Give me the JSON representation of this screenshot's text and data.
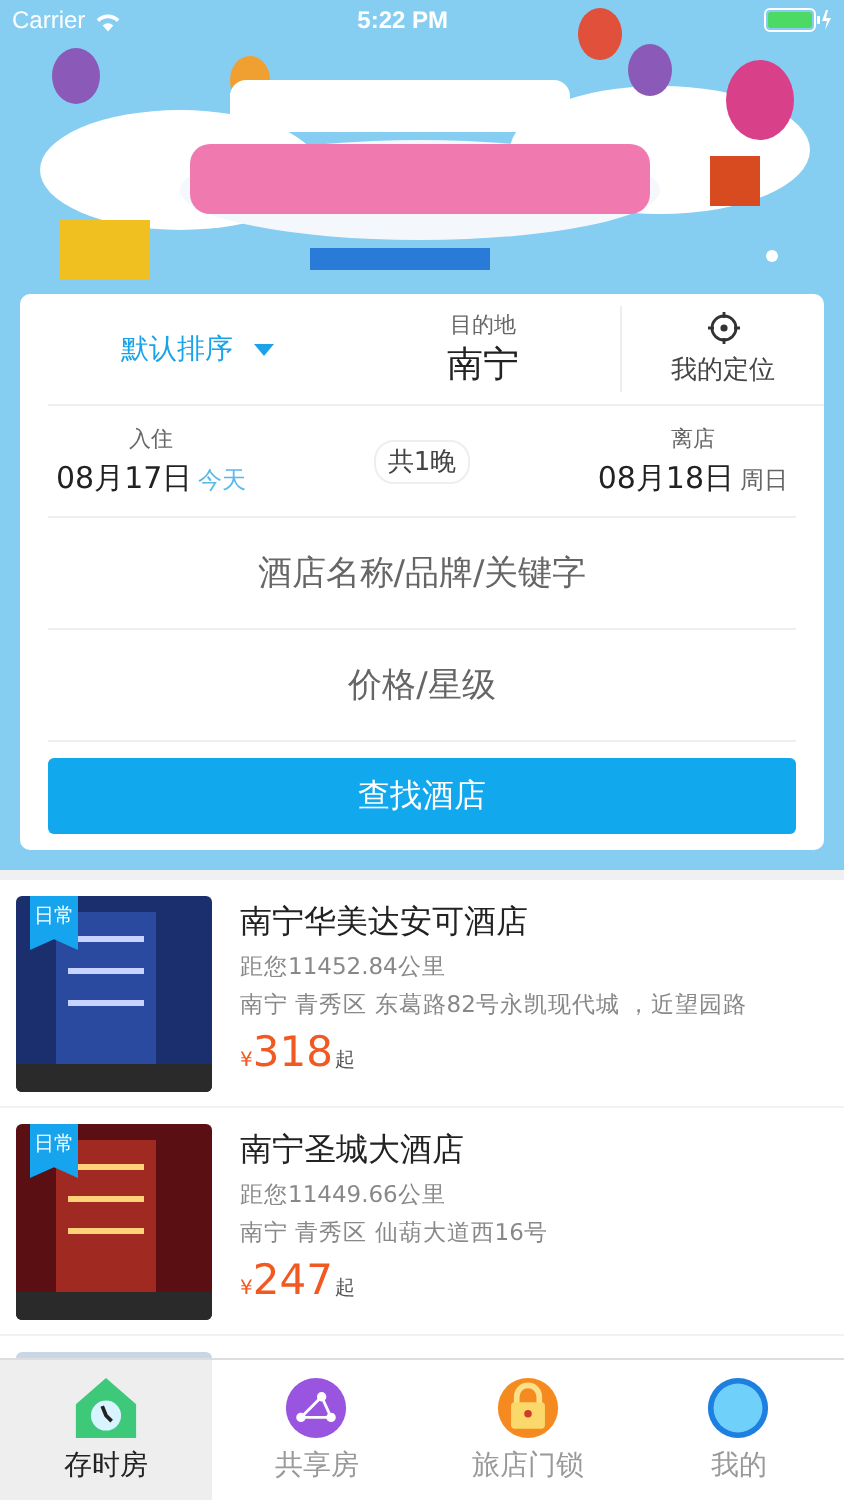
{
  "status_bar": {
    "carrier": "Carrier",
    "time": "5:22 PM"
  },
  "banner": {
    "kind": "picture"
  },
  "search": {
    "sort": "默认排序",
    "destination_label": "目的地",
    "destination": "南宁",
    "locate": "我的定位",
    "checkin_label": "入住",
    "checkin_date": "08月17日",
    "checkin_note": "今天",
    "nights": "共1晚",
    "checkout_label": "离店",
    "checkout_date": "08月18日",
    "checkout_note": "周日",
    "keyword_placeholder": "酒店名称/品牌/关键字",
    "price_placeholder": "价格/星级",
    "button": "查找酒店"
  },
  "hotels": [
    {
      "tag": "日常",
      "name": "南宁华美达安可酒店",
      "distance": "距您11452.84公里",
      "address": "南宁 青秀区 东葛路82号永凯现代城 ，近望园路",
      "currency": "¥",
      "price": "318",
      "suffix": "起",
      "kind": "picture"
    },
    {
      "tag": "日常",
      "name": "南宁圣城大酒店",
      "distance": "距您11449.66公里",
      "address": "南宁 青秀区 仙葫大道西16号",
      "currency": "¥",
      "price": "247",
      "suffix": "起",
      "kind": "picture"
    },
    {
      "kind": "picture"
    }
  ],
  "tabs": [
    {
      "label": "存时房",
      "selected": true,
      "kind": "house"
    },
    {
      "label": "共享房",
      "selected": false,
      "kind": "share"
    },
    {
      "label": "旅店门锁",
      "selected": false,
      "kind": "lock"
    },
    {
      "label": "我的",
      "selected": false,
      "kind": "me"
    }
  ]
}
